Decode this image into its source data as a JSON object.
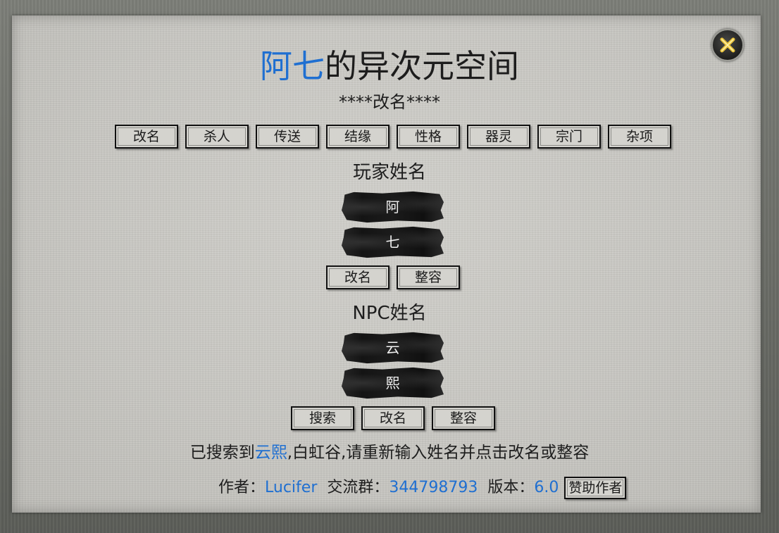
{
  "window": {
    "title_player": "阿七",
    "title_suffix": "的异次元空间",
    "section_header": "****改名****",
    "close_icon": "close-x-icon"
  },
  "tabs": [
    {
      "label": "改名"
    },
    {
      "label": "杀人"
    },
    {
      "label": "传送"
    },
    {
      "label": "结缘"
    },
    {
      "label": "性格"
    },
    {
      "label": "器灵"
    },
    {
      "label": "宗门"
    },
    {
      "label": "杂项"
    }
  ],
  "player": {
    "label": "玩家姓名",
    "surname": "阿",
    "given_name": "七",
    "rename_button": "改名",
    "reshape_button": "整容"
  },
  "npc": {
    "label": "NPC姓名",
    "surname": "云",
    "given_name": "熙",
    "search_button": "搜索",
    "rename_button": "改名",
    "reshape_button": "整容"
  },
  "status": {
    "prefix": "已搜索到",
    "found_name": "云熙",
    "suffix": ",白虹谷,请重新输入姓名并点击改名或整容"
  },
  "footer": {
    "author_label": "作者：",
    "author": "Lucifer",
    "group_label": "交流群：",
    "group": "344798793",
    "version_label": "版本：",
    "version": "6.0",
    "sponsor_button": "赞助作者"
  },
  "colors": {
    "accent_blue": "#1f6fd1",
    "panel_bg": "#c8c7c2",
    "text": "#1d1d1d"
  }
}
